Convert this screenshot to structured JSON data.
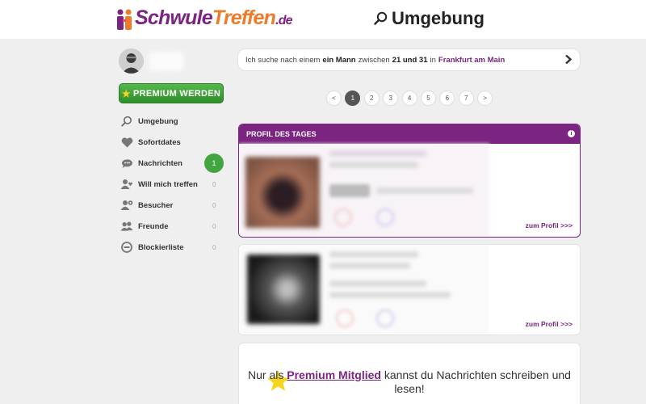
{
  "header": {
    "logo": {
      "part1": "Schwule",
      "part2": "Treffen",
      "part3": ".de"
    },
    "title": "Umgebung",
    "title_icon": "search-icon"
  },
  "sidebar": {
    "premium_button": "PREMIUM WERDEN",
    "items": [
      {
        "label": "Umgebung",
        "icon": "search-icon",
        "count": ""
      },
      {
        "label": "Sofortdates",
        "icon": "heart-icon",
        "count": ""
      },
      {
        "label": "Nachrichten",
        "icon": "chat-icon",
        "count": ""
      },
      {
        "label": "Will mich treffen",
        "icon": "user-heart-icon",
        "count": "0"
      },
      {
        "label": "Besucher",
        "icon": "visitor-icon",
        "count": "0"
      },
      {
        "label": "Freunde",
        "icon": "friends-icon",
        "count": "0"
      },
      {
        "label": "Blockierliste",
        "icon": "block-icon",
        "count": "0"
      }
    ],
    "messages_badge": "1"
  },
  "search": {
    "prefix": "Ich suche nach einem",
    "gender": "ein Mann",
    "between": "zwischen",
    "age_range": "21 und 31",
    "in": "in",
    "city": "Frankfurt am Main"
  },
  "pagination": {
    "prev": "<",
    "pages": [
      "1",
      "2",
      "3",
      "4",
      "5",
      "6",
      "7"
    ],
    "next": ">",
    "current": "1"
  },
  "profile_of_day": {
    "heading": "PROFIL DES TAGES",
    "link": "zum Profil >>>"
  },
  "second_profile": {
    "link": "zum Profil >>>"
  },
  "premium_notice": {
    "before": "Nur als",
    "link": "Premium Mitglied",
    "after": "kannst du Nachrichten schreiben und lesen!"
  },
  "colors": {
    "brand_purple": "#7b2481",
    "brand_orange": "#ee7b2a",
    "green": "#42a640"
  }
}
